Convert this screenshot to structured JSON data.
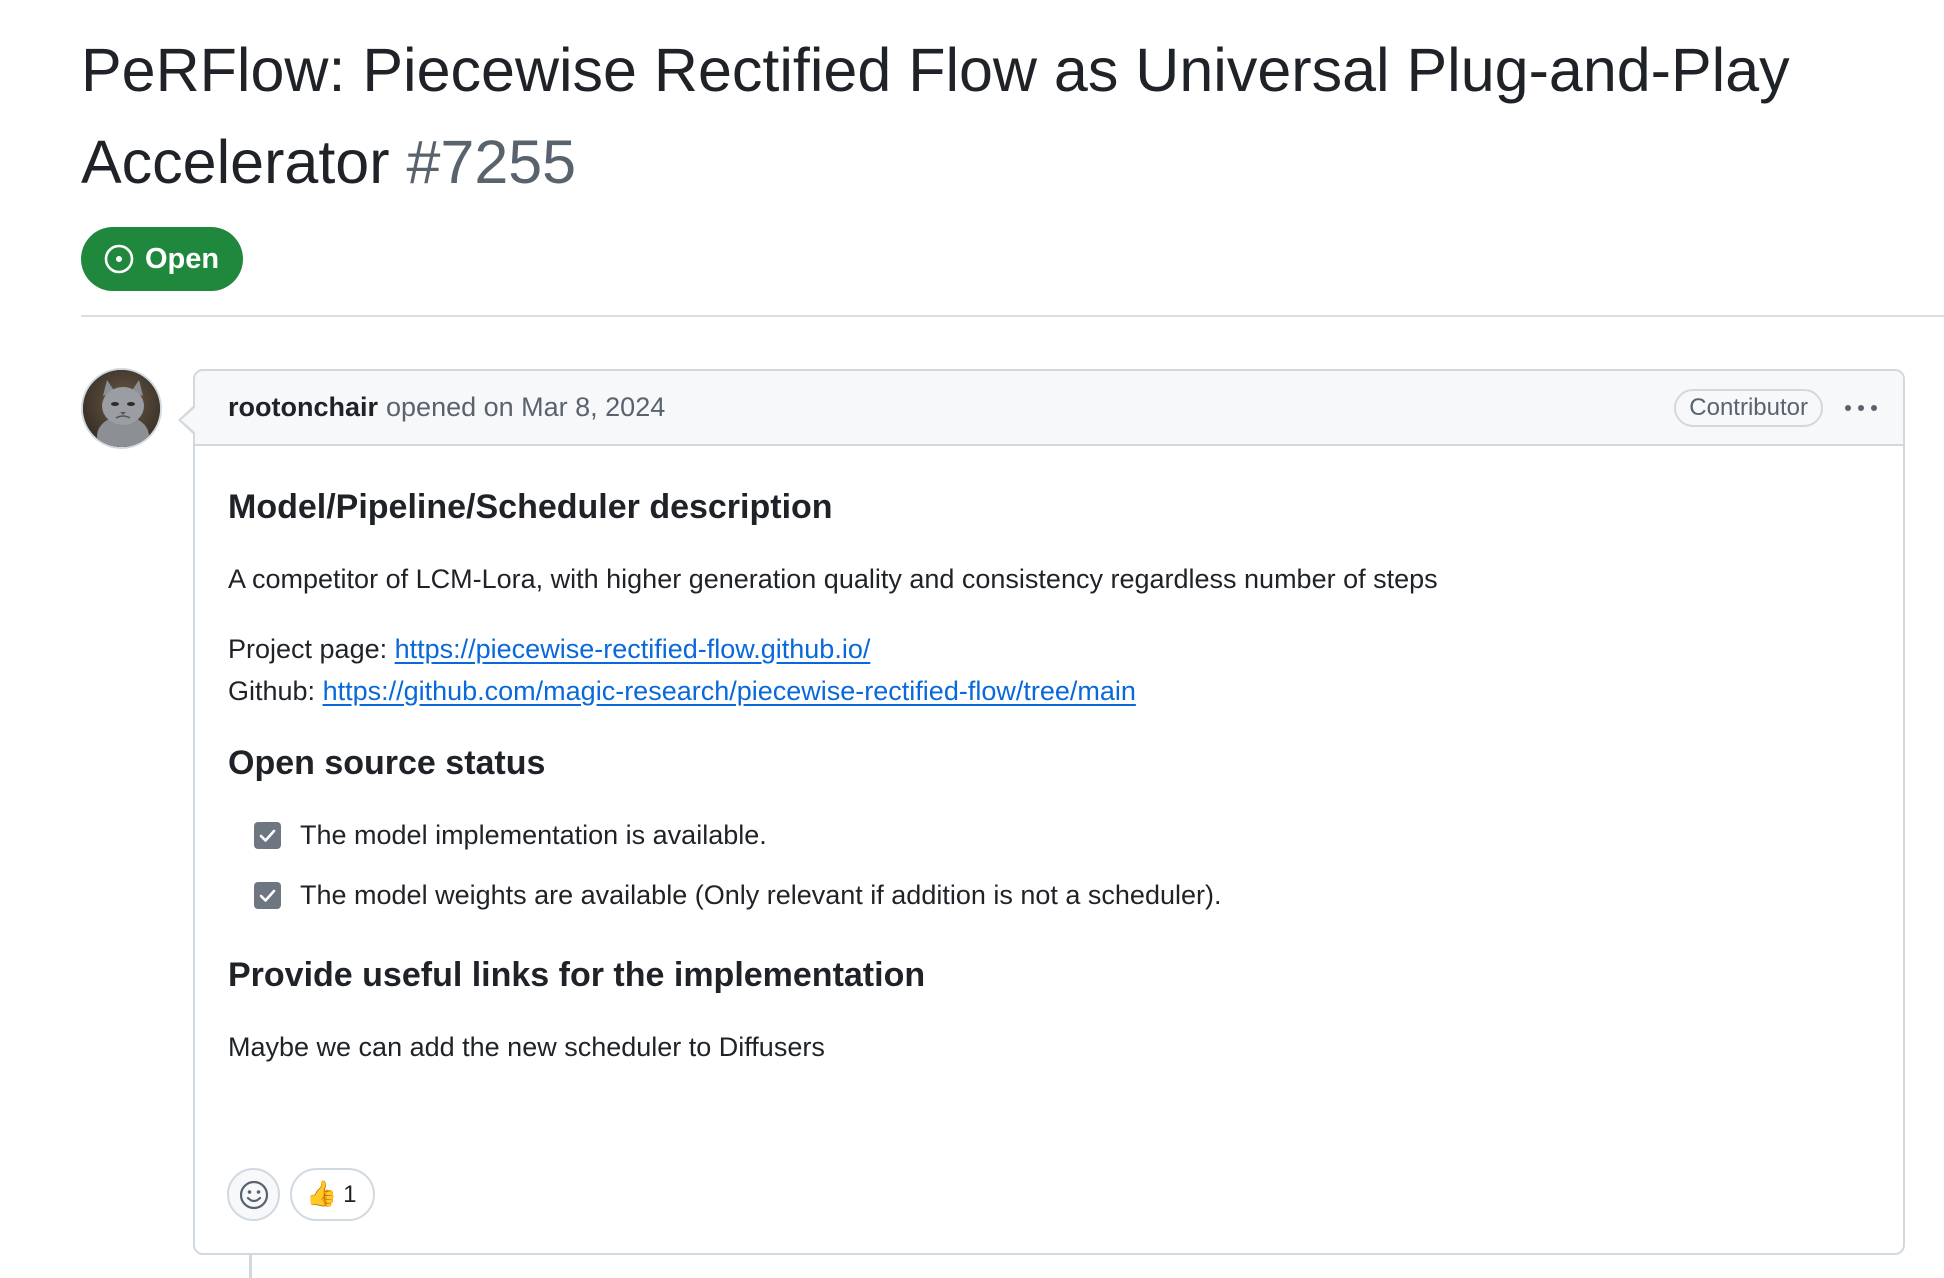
{
  "issue": {
    "title": "PeRFlow: Piecewise Rectified Flow as Universal Plug-and-Play Accelerator",
    "number": "#7255",
    "state": "Open"
  },
  "comment": {
    "author": "rootonchair",
    "opened_text": "opened on Mar 8, 2024",
    "role": "Contributor",
    "menu_icon": "kebab-horizontal-icon",
    "sections": {
      "h1": "Model/Pipeline/Scheduler description",
      "description": "A competitor of LCM-Lora, with higher generation quality and consistency regardless number of steps",
      "project_label": "Project page: ",
      "project_url": "https://piecewise-rectified-flow.github.io/",
      "github_label": "Github: ",
      "github_url": "https://github.com/magic-research/piecewise-rectified-flow/tree/main",
      "h2": "Open source status",
      "checklist": [
        {
          "label": "The model implementation is available.",
          "checked": true
        },
        {
          "label": "The model weights are available (Only relevant if addition is not a scheduler).",
          "checked": true
        }
      ],
      "h3": "Provide useful links for the implementation",
      "links_text": "Maybe we can add the new scheduler to Diffusers"
    },
    "reactions": {
      "add_icon": "smiley-icon",
      "thumbs_up_emoji": "👍",
      "thumbs_up_count": "1"
    }
  },
  "colors": {
    "open_green": "#1f883d",
    "link_blue": "#0969da",
    "border": "#d1d9e0",
    "muted_text": "#59636e"
  }
}
